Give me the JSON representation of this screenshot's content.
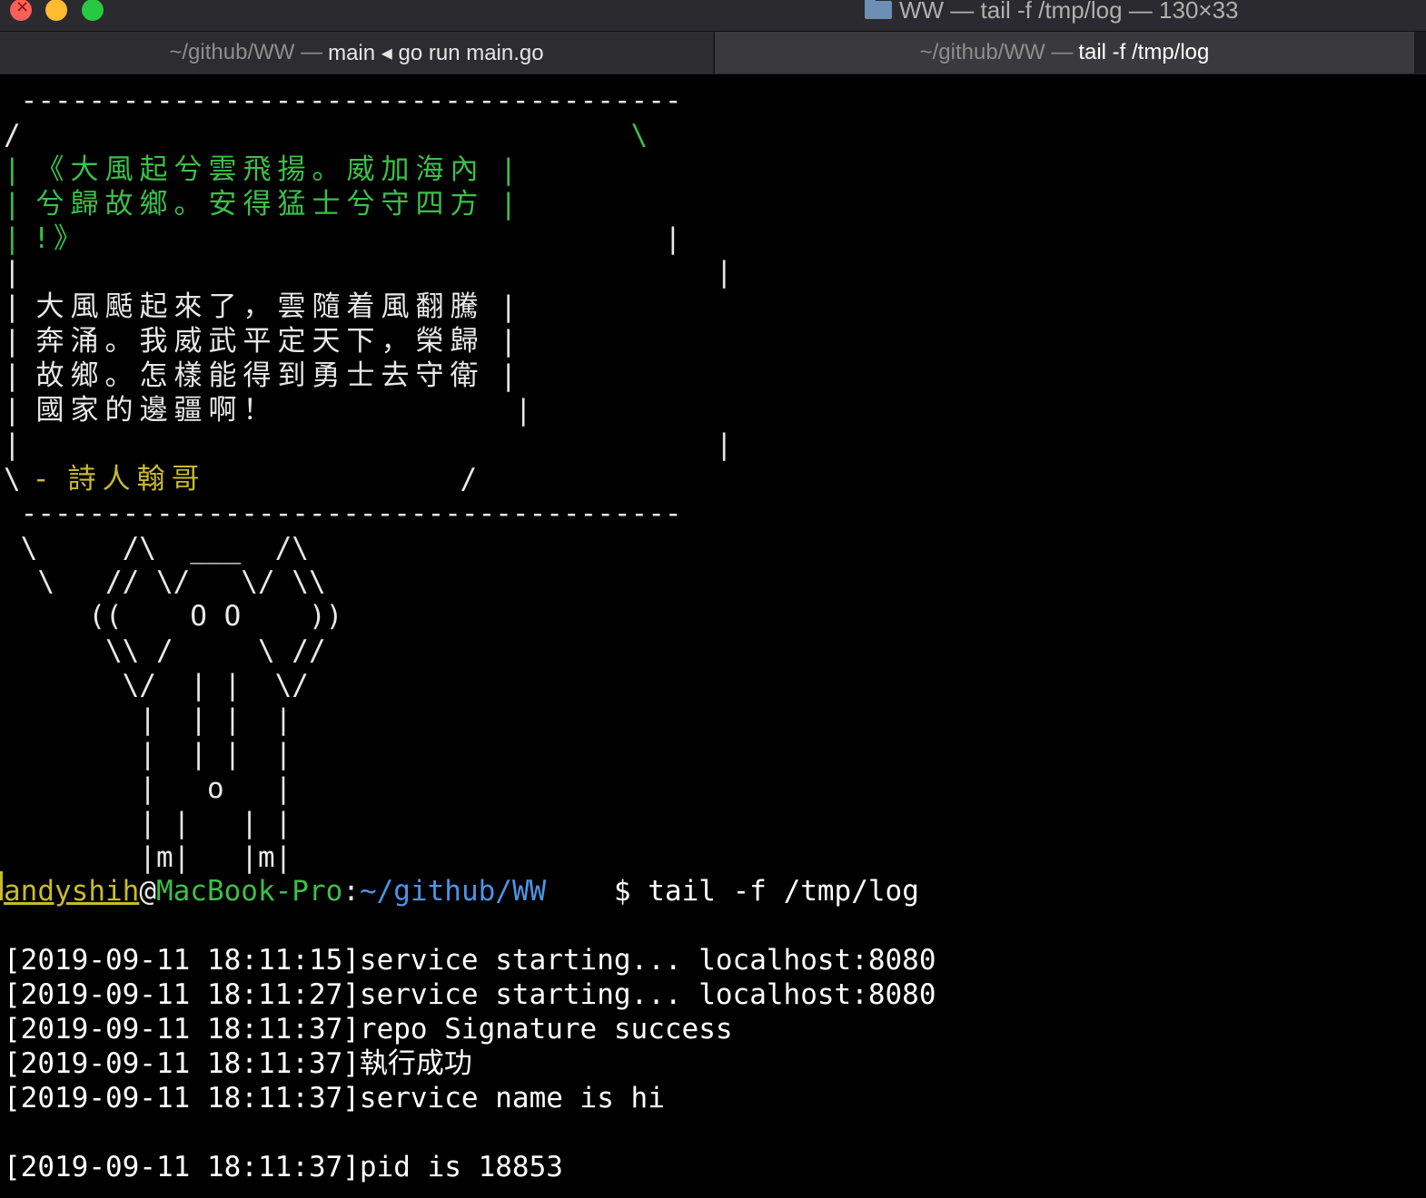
{
  "window": {
    "title": "WW — tail -f /tmp/log — 130×33"
  },
  "tabs": [
    {
      "dim": "~/github/WW —",
      "label": "main ◂ go run main.go"
    },
    {
      "dim": "~/github/WW —",
      "label": "tail -f /tmp/log"
    }
  ],
  "banner": {
    "top_border": " --------------------------------------- ",
    "bottom_border": " --------------------------------------- ",
    "lines": [
      {
        "left": "/",
        "text": "",
        "right": "                                    \\"
      },
      {
        "left": "|",
        "text": " 《大風起兮雲飛揚。威加海內 ",
        "right": "|"
      },
      {
        "left": "|",
        "text": " 兮歸故鄉。安得猛士兮守四方 ",
        "right": "|"
      },
      {
        "left": "|",
        "text": " !》",
        "right": "                                  |"
      },
      {
        "left": "|",
        "text": "",
        "right": "                                         |"
      },
      {
        "left": "|",
        "text": " 大風颳起來了，雲隨着風翻騰 ",
        "right": "|"
      },
      {
        "left": "|",
        "text": " 奔涌。我威武平定天下，榮歸 ",
        "right": "|"
      },
      {
        "left": "|",
        "text": " 故鄉。怎樣能得到勇士去守衛 ",
        "right": "|"
      },
      {
        "left": "|",
        "text": " 國家的邊疆啊！",
        "right": "              |"
      },
      {
        "left": "|",
        "text": "",
        "right": "                                         |"
      },
      {
        "left": "\\",
        "text": " - 詩人翰哥",
        "right": "               /"
      }
    ]
  },
  "ascii_art": [
    " \\     /\\  ___  /\\",
    "  \\   // \\/   \\/ \\\\",
    "     ((    O O    ))",
    "      \\\\ /     \\ //",
    "       \\/  | |  \\/",
    "        |  | |  |",
    "        |  | |  |",
    "        |   o   |",
    "        | |   | |",
    "        |m|   |m|"
  ],
  "prompt": {
    "user": "andyshih",
    "at": "@",
    "host": "MacBook-Pro",
    "colon": ":",
    "path": "~/github/WW",
    "command": "    $ tail -f /tmp/log"
  },
  "log": [
    "[2019-09-11 18:11:15]service starting... localhost:8080",
    "[2019-09-11 18:11:27]service starting... localhost:8080",
    "[2019-09-11 18:11:37]repo Signature success",
    "[2019-09-11 18:11:37]執行成功",
    "[2019-09-11 18:11:37]service name is hi",
    "",
    "[2019-09-11 18:11:37]pid is 18853"
  ]
}
